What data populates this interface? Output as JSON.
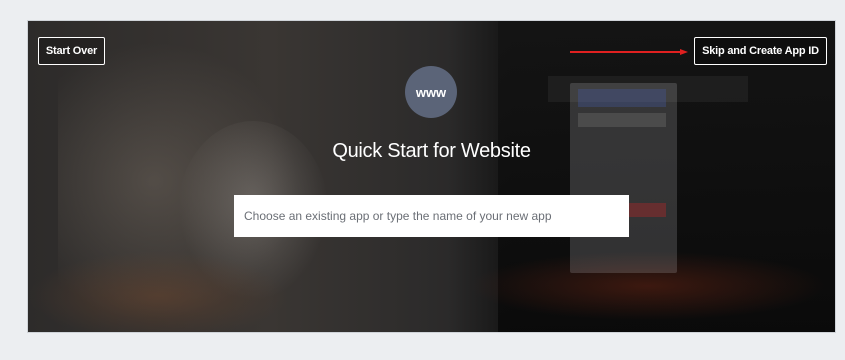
{
  "hero": {
    "start_over_label": "Start Over",
    "skip_label": "Skip and Create App ID",
    "www_label": "www",
    "title": "Quick Start for Website",
    "app_input": {
      "placeholder": "Choose an existing app or type the name of your new app",
      "value": ""
    }
  },
  "colors": {
    "arrow": "#e02020",
    "www_circle": "#5b6478",
    "page_background": "#eceef1"
  },
  "icons": {
    "annotation_arrow": "right-arrow-icon"
  }
}
